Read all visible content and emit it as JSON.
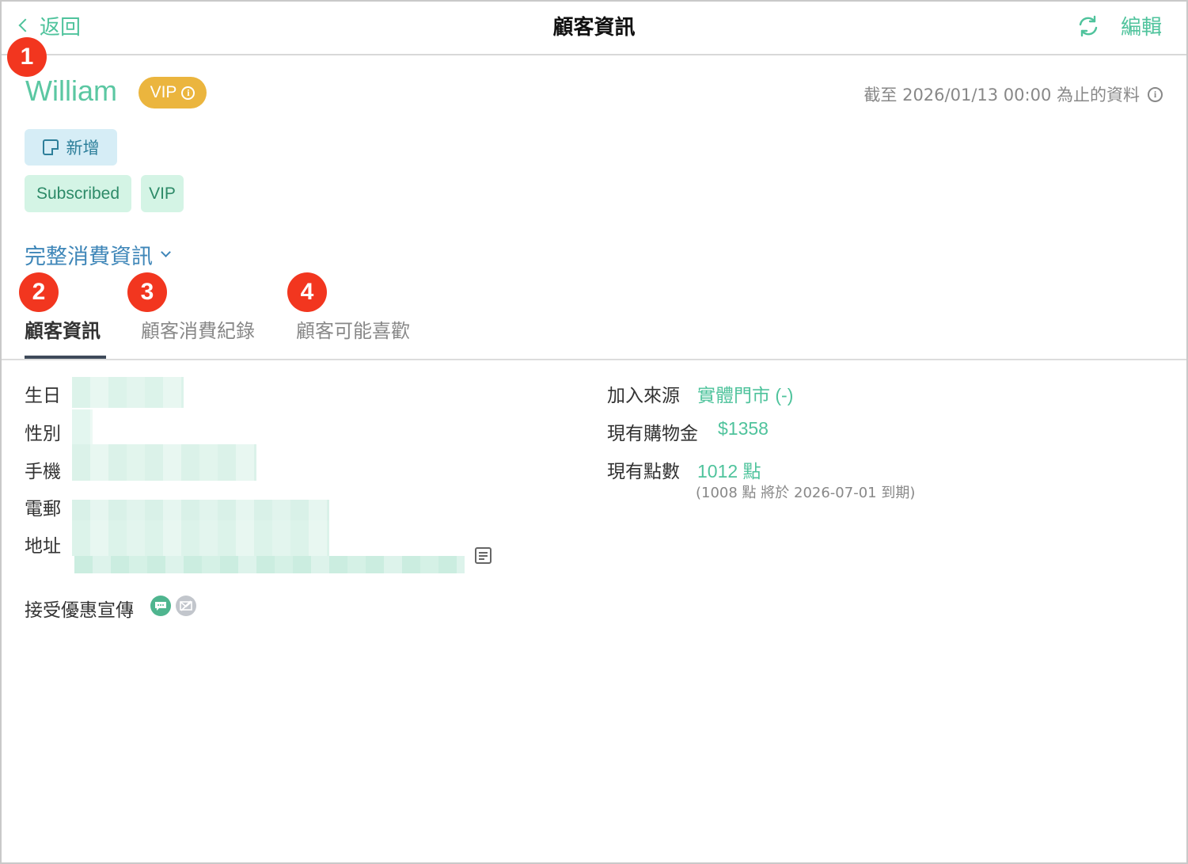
{
  "header": {
    "back_label": "返回",
    "title": "顧客資訊",
    "edit_label": "編輯",
    "refresh_icon": "refresh-icon"
  },
  "markers": [
    "1",
    "2",
    "3",
    "4"
  ],
  "customer": {
    "name": "William",
    "badge_label": "VIP",
    "data_date_text": "截至 2026/01/13 00:00 為止的資料"
  },
  "actions": {
    "add_note_label": "新增"
  },
  "tags": [
    "Subscribed",
    "VIP"
  ],
  "full_info_toggle": "完整消費資訊",
  "tabs": [
    {
      "label": "顧客資訊",
      "active": true
    },
    {
      "label": "顧客消費紀錄",
      "active": false
    },
    {
      "label": "顧客可能喜歡",
      "active": false
    }
  ],
  "profile": {
    "birthday_label": "生日",
    "gender_label": "性別",
    "phone_label": "手機",
    "email_label": "電郵",
    "address_label": "地址",
    "promo_label": "接受優惠宣傳"
  },
  "stats": {
    "source_label": "加入來源",
    "source_value": "實體門市 (-)",
    "credit_label": "現有購物金",
    "credit_value": "$1358",
    "points_label": "現有點數",
    "points_value": "1012 點",
    "points_note": "(1008 點 將於 2026-07-01 到期)"
  },
  "colors": {
    "accent_green": "#4fc39c",
    "vip_badge": "#ebb53e",
    "marker_red": "#f2361f",
    "link_blue": "#3e86b8"
  }
}
